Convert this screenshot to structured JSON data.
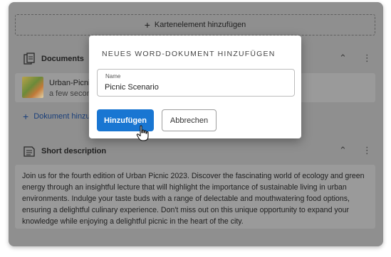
{
  "add_card": {
    "label": "Kartenelement hinzufügen",
    "icon": "plus-icon"
  },
  "documents": {
    "title": "Documents",
    "icon": "documents-icon",
    "item": {
      "name": "Urban-Picnic",
      "time": "a few secon"
    },
    "add_label": "Dokument hinzu"
  },
  "short_description": {
    "title": "Short description",
    "icon": "description-icon",
    "text": "Join us for the fourth edition of Urban Picnic 2023. Discover the fascinating world of ecology and green energy through an insightful lecture that will highlight the importance of sustainable living in urban environments. Indulge your taste buds with a range of delectable and mouthwatering food options, ensuring a delightful culinary experience. Don't miss out on this unique opportunity to expand your knowledge while enjoying a delightful picnic in the heart of the city."
  },
  "dialog": {
    "title": "Neues Word-Dokument hinzufügen",
    "field_label": "Name",
    "field_value": "Picnic Scenario",
    "primary_button": "Hinzufügen",
    "secondary_button": "Abbrechen"
  },
  "colors": {
    "primary": "#1976d2",
    "overlay": "#8f8f8f",
    "link": "#1a3f7a"
  }
}
